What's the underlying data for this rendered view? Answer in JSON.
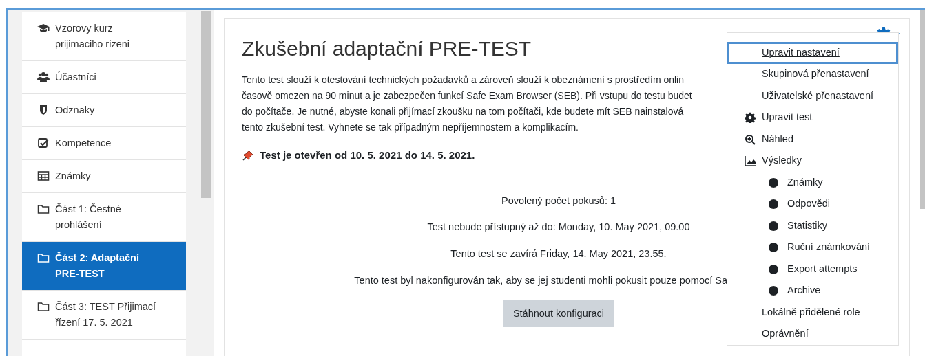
{
  "sidebar": {
    "items": [
      {
        "label": "Vzorovy kurz prijimaciho rizeni",
        "kind": "course",
        "selected": false
      },
      {
        "label": "Účastníci",
        "kind": "participants",
        "selected": false
      },
      {
        "label": "Odznaky",
        "kind": "badges",
        "selected": false
      },
      {
        "label": "Kompetence",
        "kind": "competencies",
        "selected": false
      },
      {
        "label": "Známky",
        "kind": "grades",
        "selected": false
      },
      {
        "label": "Část 1: Čestné prohlášení",
        "kind": "section",
        "selected": false
      },
      {
        "label": "Část 2: Adaptační PRE-TEST",
        "kind": "section",
        "selected": true
      },
      {
        "label": "Část 3: TEST Přijimací řízení 17. 5. 2021",
        "kind": "section",
        "selected": false
      }
    ]
  },
  "main": {
    "title": "Zkušební adaptační PRE-TEST",
    "intro_lines": [
      "Tento test slouží k otestování technických požadavků a zároveň slouží k obeznámení s prostředím onlin",
      "časově omezen na 90 minut a je zabezpečen funkcí Safe Exam Browser (SEB). Při vstupu do testu budet",
      "do počítače. Je nutné, abyste konali přijímací zkoušku na tom počítači, kde budete mít SEB nainstalová",
      "tento zkušební test. Vyhnete se tak případným nepříjemnostem a komplikacím."
    ],
    "open_notice": "Test je otevřen od 10. 5. 2021 do 14. 5. 2021.",
    "info_lines": [
      {
        "text": "Povolený počet pokusů: 1",
        "cut": false
      },
      {
        "text": "Test nebude přístupný až do: Monday, 10. May 2021, 09.00",
        "cut": false
      },
      {
        "text": "Tento test se zavírá Friday, 14. May 2021, 23.55.",
        "cut": false
      },
      {
        "text": "Tento test byl nakonfigurován tak, aby se jej studenti mohli pokusit pouze pomocí Sa",
        "cut": true
      }
    ],
    "download_button": "Stáhnout konfiguraci"
  },
  "settings_menu": {
    "expanded": true,
    "items": [
      {
        "label": "Upravit nastavení",
        "kind": "plain",
        "focused": true
      },
      {
        "label": "Skupinová přenastavení",
        "kind": "plain",
        "focused": false
      },
      {
        "label": "Uživatelské přenastavení",
        "kind": "plain",
        "focused": false
      },
      {
        "label": "Upravit test",
        "kind": "cog",
        "focused": false
      },
      {
        "label": "Náhled",
        "kind": "preview",
        "focused": false
      },
      {
        "label": "Výsledky",
        "kind": "results",
        "focused": false
      },
      {
        "label": "Známky",
        "kind": "bullet",
        "focused": false
      },
      {
        "label": "Odpovědi",
        "kind": "bullet",
        "focused": false
      },
      {
        "label": "Statistiky",
        "kind": "bullet",
        "focused": false
      },
      {
        "label": "Ruční známkování",
        "kind": "bullet",
        "focused": false
      },
      {
        "label": "Export attempts",
        "kind": "bullet",
        "focused": false
      },
      {
        "label": "Archive",
        "kind": "bullet",
        "focused": false
      },
      {
        "label": "Lokálně přidělené role",
        "kind": "plain",
        "focused": false
      },
      {
        "label": "Oprávnění",
        "kind": "plain",
        "focused": false
      }
    ]
  }
}
